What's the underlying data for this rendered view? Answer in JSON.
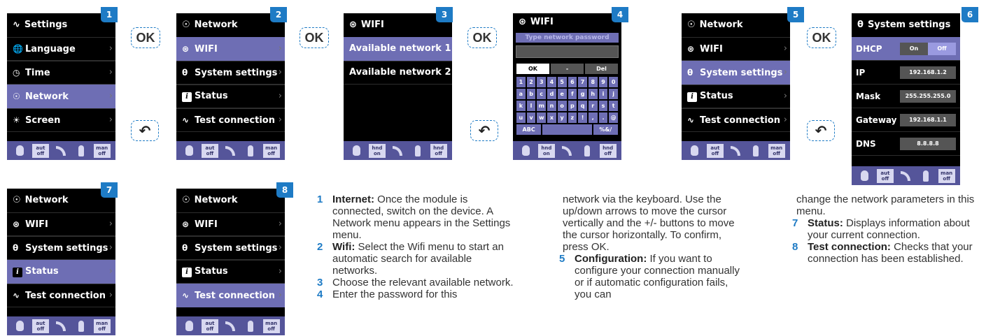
{
  "screens": {
    "s1": {
      "badge": "1",
      "title": "Settings",
      "rows": [
        "Language",
        "Time",
        "Network",
        "Screen"
      ],
      "status": {
        "left": "aut\noff",
        "right": "man\noff"
      }
    },
    "s2": {
      "badge": "2",
      "title": "Network",
      "rows": [
        "WIFI",
        "System settings",
        "Status",
        "Test connection"
      ],
      "status": {
        "left": "aut\noff",
        "right": "man\noff"
      }
    },
    "s3": {
      "badge": "3",
      "title": "WIFI",
      "rows": [
        "Available network 1",
        "Available network 2"
      ],
      "status": {
        "left": "hnd\non",
        "right": "hnd\noff"
      }
    },
    "s4": {
      "badge": "4",
      "title": "WIFI",
      "prompt": "Type network password",
      "keys_top": [
        "OK",
        "-",
        "Del"
      ],
      "keys_r1": [
        "1",
        "2",
        "3",
        "4",
        "5",
        "6",
        "7",
        "8",
        "9",
        "0"
      ],
      "keys_r2": [
        "a",
        "b",
        "c",
        "d",
        "e",
        "f",
        "g",
        "h",
        "i",
        "j"
      ],
      "keys_r3": [
        "k",
        "l",
        "m",
        "n",
        "o",
        "p",
        "q",
        "r",
        "s",
        "t"
      ],
      "keys_r4": [
        "u",
        "v",
        "w",
        "x",
        "y",
        "z",
        "!",
        ",",
        ".",
        "@"
      ],
      "keys_r5": [
        "ABC",
        "",
        "%&/"
      ],
      "status": {
        "left": "hnd\non",
        "right": "hnd\noff"
      }
    },
    "s5": {
      "badge": "5",
      "title": "Network",
      "rows": [
        "WIFI",
        "System settings",
        "Status",
        "Test connection"
      ],
      "status": {
        "left": "aut\noff",
        "right": "man\noff"
      }
    },
    "s6": {
      "badge": "6",
      "title": "System settings",
      "dhcp_label": "DHCP",
      "dhcp_on": "On",
      "dhcp_off": "Off",
      "fields": [
        {
          "label": "IP",
          "value": "192.168.1.2"
        },
        {
          "label": "Mask",
          "value": "255.255.255.0"
        },
        {
          "label": "Gateway",
          "value": "192.168.1.1"
        },
        {
          "label": "DNS",
          "value": "8.8.8.8"
        }
      ],
      "status": {
        "left": "aut\noff",
        "right": "man\noff"
      }
    },
    "s7": {
      "badge": "7",
      "title": "Network",
      "rows": [
        "WIFI",
        "System settings",
        "Status",
        "Test connection"
      ],
      "status": {
        "left": "aut\noff",
        "right": "man\noff"
      }
    },
    "s8": {
      "badge": "8",
      "title": "Network",
      "rows": [
        "WIFI",
        "System settings",
        "Status",
        "Test connection"
      ],
      "status": {
        "left": "aut\noff",
        "right": "man\noff"
      }
    }
  },
  "ok_label": "OK",
  "text": {
    "col1": {
      "n1": "1",
      "t1_bold": "Internet:",
      "t1": " Once the module is connected, switch on the device. A Network menu appears in the Settings menu.",
      "n2": "2",
      "t2_bold": "Wifi:",
      "t2": " Select the Wifi menu to start an automatic search for available networks.",
      "n3": "3",
      "t3": "Choose the relevant available network.",
      "n4": "4",
      "t4": "Enter the password for this"
    },
    "col2": {
      "t4_cont": "network via the keyboard. Use the up/down arrows to move the cursor vertically and the +/- buttons to move the cursor horizontally. To confirm, press OK.",
      "n5": "5",
      "t5_bold": "Configuration:",
      "t5": " If you want to configure your connection manually or if automatic configuration fails, you can"
    },
    "col3": {
      "t5_cont": "change the network parameters in this menu.",
      "n7": "7",
      "t7_bold": "Status:",
      "t7": " Displays information about your current connection.",
      "n8": "8",
      "t8_bold": "Test connection:",
      "t8": " Checks that your connection has been established."
    }
  }
}
